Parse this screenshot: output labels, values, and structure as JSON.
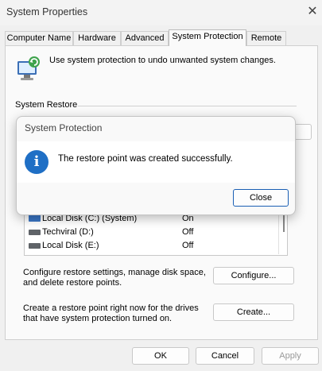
{
  "window": {
    "title": "System Properties",
    "close_glyph": "✕"
  },
  "tabs": [
    {
      "label": "Computer Name",
      "active": false
    },
    {
      "label": "Hardware",
      "active": false
    },
    {
      "label": "Advanced",
      "active": false
    },
    {
      "label": "System Protection",
      "active": true
    },
    {
      "label": "Remote",
      "active": false
    }
  ],
  "intro_text": "Use system protection to undo unwanted system changes.",
  "system_restore": {
    "section_label": "System Restore"
  },
  "drives": [
    {
      "name": "Local Disk (C:) (System)",
      "protection": "On",
      "icon": "system-drive-icon"
    },
    {
      "name": "Techviral (D:)",
      "protection": "Off",
      "icon": "drive-icon"
    },
    {
      "name": "Local Disk (E:)",
      "protection": "Off",
      "icon": "drive-icon"
    }
  ],
  "configure": {
    "description": "Configure restore settings, manage disk space, and delete restore points.",
    "button_label": "Configure..."
  },
  "create": {
    "description": "Create a restore point right now for the drives that have system protection turned on.",
    "button_label": "Create..."
  },
  "footer": {
    "ok_label": "OK",
    "cancel_label": "Cancel",
    "apply_label": "Apply"
  },
  "dialog": {
    "title": "System Protection",
    "message": "The restore point was created successfully.",
    "close_label": "Close",
    "icon": "info-icon"
  },
  "colors": {
    "accent": "#1f6fc5",
    "focus_border": "#1a5fb4"
  }
}
